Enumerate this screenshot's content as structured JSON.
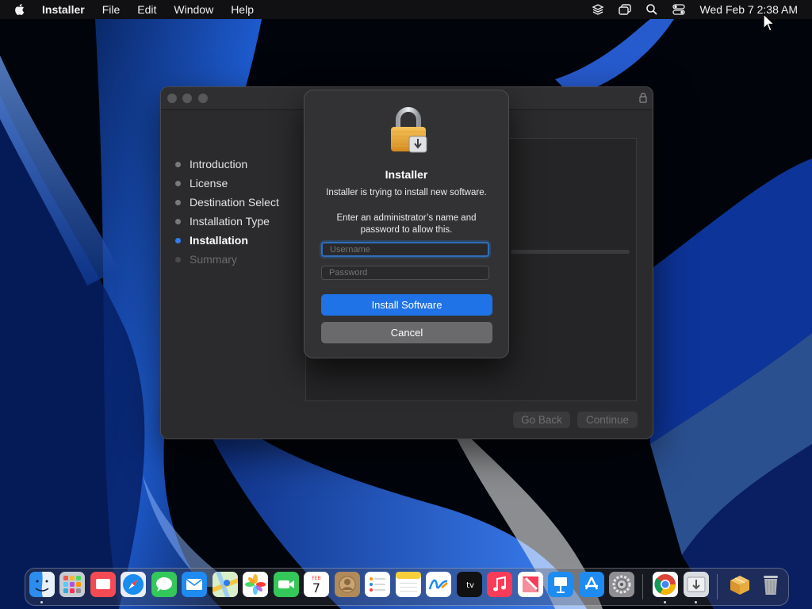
{
  "menubar": {
    "app_name": "Installer",
    "menus": [
      "File",
      "Edit",
      "Window",
      "Help"
    ],
    "clock": "Wed Feb 7  2:38 AM",
    "status_icons": [
      "layers-icon",
      "screen-mirroring-icon",
      "search-icon",
      "control-center-icon"
    ]
  },
  "installer": {
    "steps": [
      {
        "label": "Introduction",
        "state": "done"
      },
      {
        "label": "License",
        "state": "done"
      },
      {
        "label": "Destination Select",
        "state": "done"
      },
      {
        "label": "Installation Type",
        "state": "done"
      },
      {
        "label": "Installation",
        "state": "active"
      },
      {
        "label": "Summary",
        "state": "pending"
      }
    ],
    "go_back_label": "Go Back",
    "continue_label": "Continue"
  },
  "auth_dialog": {
    "title": "Installer",
    "message": "Installer is trying to install new software.",
    "prompt": "Enter an administrator’s name and password to allow this.",
    "username_placeholder": "Username",
    "password_placeholder": "Password",
    "username_value": "",
    "password_value": "",
    "install_label": "Install Software",
    "cancel_label": "Cancel"
  },
  "dock": {
    "items": [
      "finder-icon",
      "launchpad-icon",
      "tv-remote-icon",
      "safari-icon",
      "messages-icon",
      "mail-icon",
      "maps-icon",
      "photos-icon",
      "facetime-icon",
      "calendar-icon",
      "contacts-icon",
      "reminders-icon",
      "notes-icon",
      "freeform-icon",
      "apple-tv-icon",
      "music-icon",
      "news-icon",
      "keynote-icon",
      "app-store-icon",
      "system-settings-icon",
      "chrome-icon",
      "installer-icon",
      "package-icon",
      "trash-icon"
    ],
    "calendar": {
      "month": "FEB",
      "day": "7"
    },
    "tv_label": "tv"
  },
  "colors": {
    "accent": "#1f73e6",
    "active_step": "#2f7ef6"
  }
}
